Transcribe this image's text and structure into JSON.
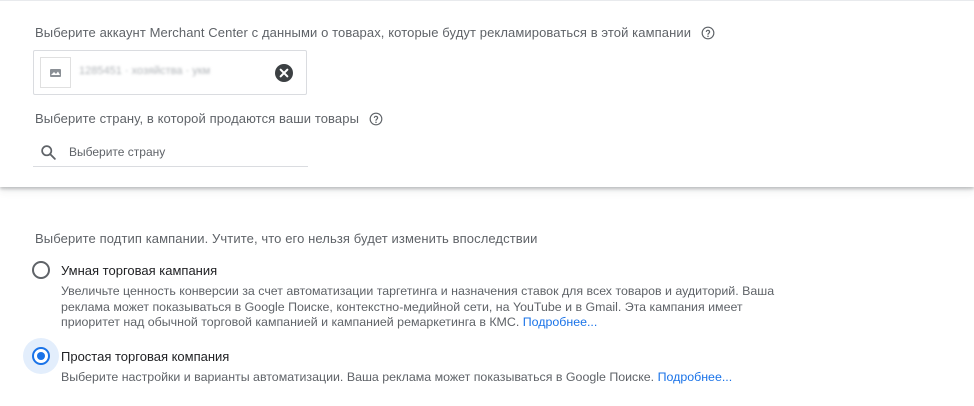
{
  "merchant": {
    "label": "Выберите аккаунт Merchant Center с данными о товарах, которые будут рекламироваться в этой кампании",
    "account_text": "1285451 · хозяйства · укм"
  },
  "country": {
    "label": "Выберите страну, в которой продаются ваши товары",
    "placeholder": "Выберите страну"
  },
  "subtype": {
    "label": "Выберите подтип кампании. Учтите, что его нельзя будет изменить впоследствии",
    "options": [
      {
        "title": "Умная торговая кампания",
        "description": "Увеличьте ценность конверсии за счет автоматизации таргетинга и назначения ставок для всех товаров и аудиторий. Ваша реклама может показываться в Google Поиске, контекстно-медийной сети, на YouTube и в Gmail. Эта кампания имеет приоритет над обычной торговой кампанией и кампанией ремаркетинга в КМС.",
        "link": "Подробнее...",
        "selected": false
      },
      {
        "title": "Простая торговая компания",
        "description": "Выберите настройки и варианты автоматизации. Ваша реклама может показываться в Google Поиске.",
        "link": "Подробнее...",
        "selected": true
      }
    ]
  },
  "colors": {
    "accent": "#1a73e8",
    "label_text": "#5f6368",
    "primary_text": "#202124"
  }
}
